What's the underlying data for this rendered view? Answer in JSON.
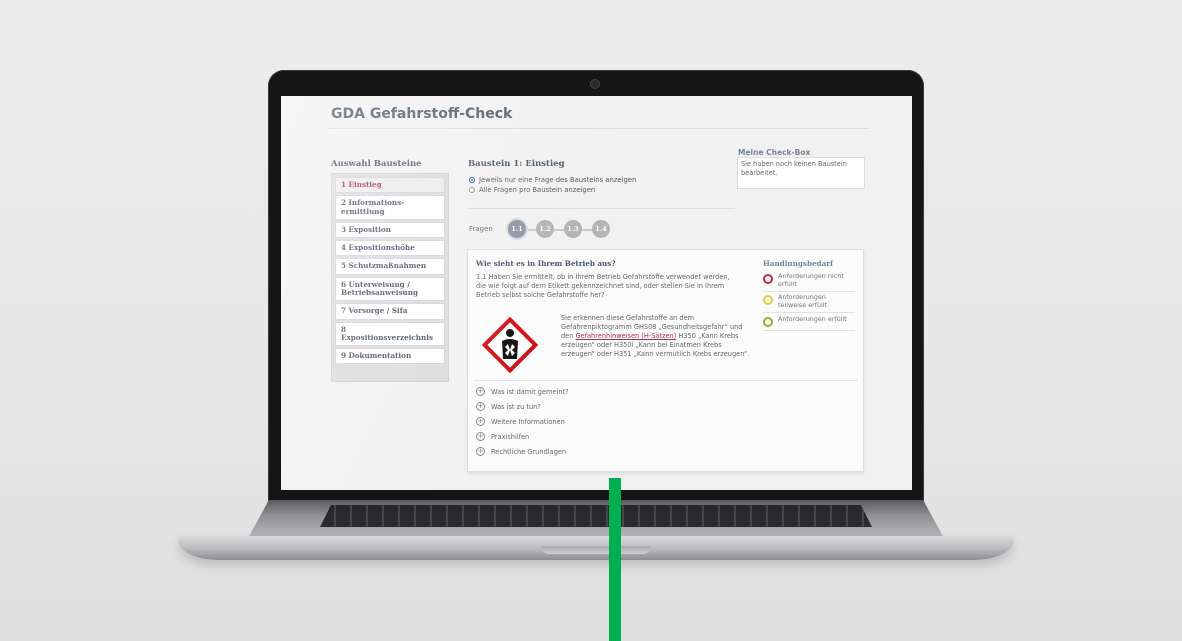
{
  "app": {
    "title": "GDA Gefahrstoff-Check"
  },
  "sidebar": {
    "heading": "Auswahl Bausteine",
    "items": [
      {
        "label": "1 Einstieg",
        "active": true
      },
      {
        "label": "2 Informations-\nermittlung"
      },
      {
        "label": "3 Exposition"
      },
      {
        "label": "4 Expositionshöhe"
      },
      {
        "label": "5 Schutzmaßnahmen"
      },
      {
        "label": "6 Unterweisung /\nBetriebsanweisung"
      },
      {
        "label": "7 Vorsorge / Sifa"
      },
      {
        "label": "8 Expositionsverzeichnis"
      },
      {
        "label": "9 Dokumentation"
      }
    ]
  },
  "baustein": {
    "title": "Baustein 1: Einstieg",
    "option_single": "Jeweils nur eine Frage des Bausteins anzeigen",
    "option_all": "Alle Fragen pro Baustein anzeigen"
  },
  "checkbox": {
    "heading": "Meine Check-Box",
    "text": "Sie haben noch keinen Baustein bearbeitet."
  },
  "fragen": {
    "label": "Fragen",
    "steps": [
      "1.1",
      "1.2",
      "1.3",
      "1.4"
    ]
  },
  "question": {
    "heading": "Wie sieht es in Ihrem Betrieb aus?",
    "text": "1.1 Haben Sie ermittelt, ob in Ihrem Betrieb Gefahrstoffe verwendet werden, die wie folgt auf dem Etikett gekennzeichnet sind, oder stellen Sie in Ihrem Betrieb selbst solche Gefahrstoffe her?",
    "sub_part1": "Sie erkennen diese Gefahrstoffe an dem Gefahrenpiktogramm GHS08 „Gesundheitsgefahr“ und den ",
    "sub_link": "Gefahrenhinweisen (H-Sätzen)",
    "sub_part2": " H350 „Kann Krebs erzeugen“ oder H350i „Kann bei Einatmen Krebs erzeugen“ oder H351 „Kann vermutlich Krebs erzeugen“."
  },
  "handlungsbedarf": {
    "heading": "Handlungsbedarf",
    "items": [
      {
        "label": "Anforderungen nicht erfüllt",
        "color": "#c8283c"
      },
      {
        "label": "Anforderungen teilweise erfüllt",
        "color": "#d8d430"
      },
      {
        "label": "Anforderungen erfüllt",
        "color": "#9aad2a"
      }
    ]
  },
  "accordion": [
    "Was ist damit gemeint?",
    "Was ist zu tun?",
    "Weitere Informationen",
    "Praxishilfen",
    "Rechtliche Grundlagen"
  ],
  "colors": {
    "accent": "#a6324a",
    "green_bar": "#00b050"
  }
}
